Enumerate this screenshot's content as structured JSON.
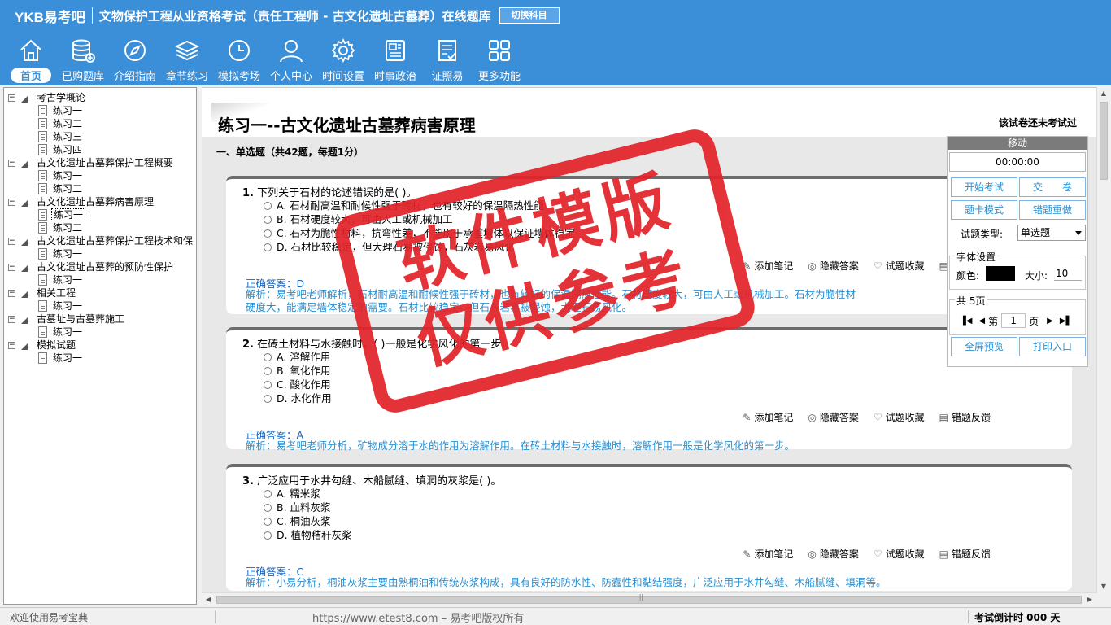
{
  "header": {
    "brand": "YKB易考吧",
    "title": "文物保护工程从业资格考试（责任工程师 - 古文化遗址古墓葬）在线题库",
    "switch_label": "切换科目",
    "nav": [
      {
        "label": "首页",
        "icon": "home-icon",
        "active": true
      },
      {
        "label": "已购题库",
        "icon": "database-icon"
      },
      {
        "label": "介绍指南",
        "icon": "compass-icon"
      },
      {
        "label": "章节练习",
        "icon": "layers-icon"
      },
      {
        "label": "模拟考场",
        "icon": "clock-icon"
      },
      {
        "label": "个人中心",
        "icon": "user-icon"
      },
      {
        "label": "时间设置",
        "icon": "gear-icon"
      },
      {
        "label": "时事政治",
        "icon": "newspaper-icon"
      },
      {
        "label": "证照易",
        "icon": "certificate-icon"
      },
      {
        "label": "更多功能",
        "icon": "grid-icon"
      }
    ]
  },
  "tree": [
    {
      "label": "考古学概论",
      "children": [
        "练习一",
        "练习二",
        "练习三",
        "练习四"
      ]
    },
    {
      "label": "古文化遗址古墓葬保护工程概要",
      "children": [
        "练习一",
        "练习二"
      ]
    },
    {
      "label": "古文化遗址古墓葬病害原理",
      "children": [
        "练习一",
        "练习二"
      ],
      "selected_child": 0
    },
    {
      "label": "古文化遗址古墓葬保护工程技术和保",
      "children": [
        "练习一"
      ]
    },
    {
      "label": "古文化遗址古墓葬的预防性保护",
      "children": [
        "练习一"
      ]
    },
    {
      "label": "相关工程",
      "children": [
        "练习一"
      ]
    },
    {
      "label": "古墓址与古墓葬施工",
      "children": [
        "练习一"
      ]
    },
    {
      "label": "模拟试题",
      "children": [
        "练习一"
      ]
    }
  ],
  "main": {
    "title": "练习一--古文化遗址古墓葬病害原理",
    "exam_status": "该试卷还未考试过",
    "section": "一、单选题（共42题，每题1分）",
    "tools": [
      "添加笔记",
      "隐藏答案",
      "试题收藏",
      "错题反馈"
    ],
    "answer_prefix": "正确答案：",
    "questions": [
      {
        "num": "1.",
        "stem": "下列关于石材的论述错误的是( )。",
        "options": [
          "A. 石材耐高温和耐候性强于砖材，也有较好的保温隔热性能",
          "B. 石材硬度较大，可由人工或机械加工",
          "C. 石材为脆性材料，抗弯性差，不能用于承重墙体以保证墙体稳定",
          "D. 石材比较稳定，但大理石易被侵蚀，石灰岩易风化"
        ],
        "answer": "D",
        "analysis1": "解析：易考吧老师解析，石材耐高温和耐候性强于砖材，也有较好的保温隔热性能。石材硬度较大，可由人工或机械加工。石材为脆性材",
        "analysis2": "硬度大，能满足墙体稳定的需要。石材比较稳定，但石灰岩易被侵蚀，大理石易风化。"
      },
      {
        "num": "2.",
        "stem": "在砖土材料与水接触时，( )一般是化学风化的第一步。",
        "options": [
          "A. 溶解作用",
          "B. 氧化作用",
          "C. 酸化作用",
          "D. 水化作用"
        ],
        "answer": "A",
        "analysis1": "解析：易考吧老师分析，矿物成分溶于水的作用为溶解作用。在砖土材料与水接触时，溶解作用一般是化学风化的第一步。",
        "analysis2": ""
      },
      {
        "num": "3.",
        "stem": "广泛应用于水井勾缝、木船腻缝、填洞的灰浆是( )。",
        "options": [
          "A. 糯米浆",
          "B. 血料灰浆",
          "C. 桐油灰浆",
          "D. 植物秸秆灰浆"
        ],
        "answer": "C",
        "analysis1": "解析：小易分析，桐油灰浆主要由熟桐油和传统灰浆构成，具有良好的防水性、防蠹性和黏结强度，广泛应用于水井勾缝、木船腻缝、填洞等。",
        "analysis2": ""
      }
    ]
  },
  "panel": {
    "move_label": "移动",
    "timer": "00:00:00",
    "start_exam": "开始考试",
    "submit": "交　　卷",
    "card_mode": "题卡模式",
    "wrong_redo": "错题重做",
    "type_label": "试题类型:",
    "type_value": "单选题",
    "font_legend": "字体设置",
    "color_label": "颜色:",
    "size_label": "大小:",
    "size_value": "10",
    "font_color": "#000000",
    "pages_legend": "共 5页",
    "page_prefix": "第",
    "page_value": "1",
    "page_suffix": "页",
    "fullscreen": "全屏预览",
    "print": "打印入口"
  },
  "status": {
    "welcome": "欢迎使用易考宝典",
    "website": "https://www.etest8.com – 易考吧版权所有",
    "countdown": "考试倒计时 000 天"
  },
  "watermark": {
    "line1": "软件模版",
    "line2": "仅供参考"
  },
  "colors": {
    "header_bg": "#3b8fd8",
    "answer": "#1a61b8",
    "analysis": "#2a8fd0",
    "stamp": "#e2242a"
  }
}
